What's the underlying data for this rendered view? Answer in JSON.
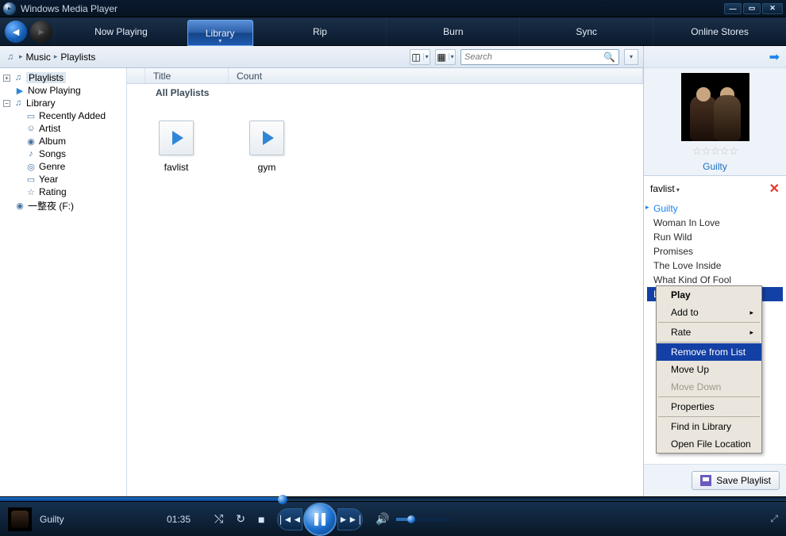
{
  "window": {
    "title": "Windows Media Player"
  },
  "nav": {
    "tabs": [
      "Now Playing",
      "Library",
      "Rip",
      "Burn",
      "Sync",
      "Online Stores"
    ],
    "active": 1
  },
  "breadcrumb": [
    "Music",
    "Playlists"
  ],
  "search": {
    "placeholder": "Search"
  },
  "tree": {
    "playlists": "Playlists",
    "now_playing": "Now Playing",
    "library": "Library",
    "recently_added": "Recently Added",
    "artist": "Artist",
    "album": "Album",
    "songs": "Songs",
    "genre": "Genre",
    "year": "Year",
    "rating": "Rating",
    "drive": "一整夜 (F:)"
  },
  "columns": {
    "title": "Title",
    "count": "Count"
  },
  "group_header": "All Playlists",
  "playlists": [
    {
      "name": "favlist"
    },
    {
      "name": "gym"
    }
  ],
  "nowplaying_album": {
    "title": "Guilty",
    "stars_label": "☆☆☆☆☆"
  },
  "pl_pane": {
    "name": "favlist",
    "tracks": [
      "Guilty",
      "Woman In Love",
      "Run Wild",
      "Promises",
      "The Love Inside",
      "What Kind Of Fool",
      "Life Story"
    ],
    "current_index": 0,
    "selected_index": 6
  },
  "context_menu": {
    "play": "Play",
    "add_to": "Add to",
    "rate": "Rate",
    "remove": "Remove from List",
    "move_up": "Move Up",
    "move_down": "Move Down",
    "properties": "Properties",
    "find": "Find in Library",
    "open_loc": "Open File Location",
    "highlighted": "remove",
    "disabled": "move_down"
  },
  "save_playlist": "Save Playlist",
  "player": {
    "track": "Guilty",
    "time": "01:35",
    "seek_percent": 36,
    "volume_percent": 28
  }
}
